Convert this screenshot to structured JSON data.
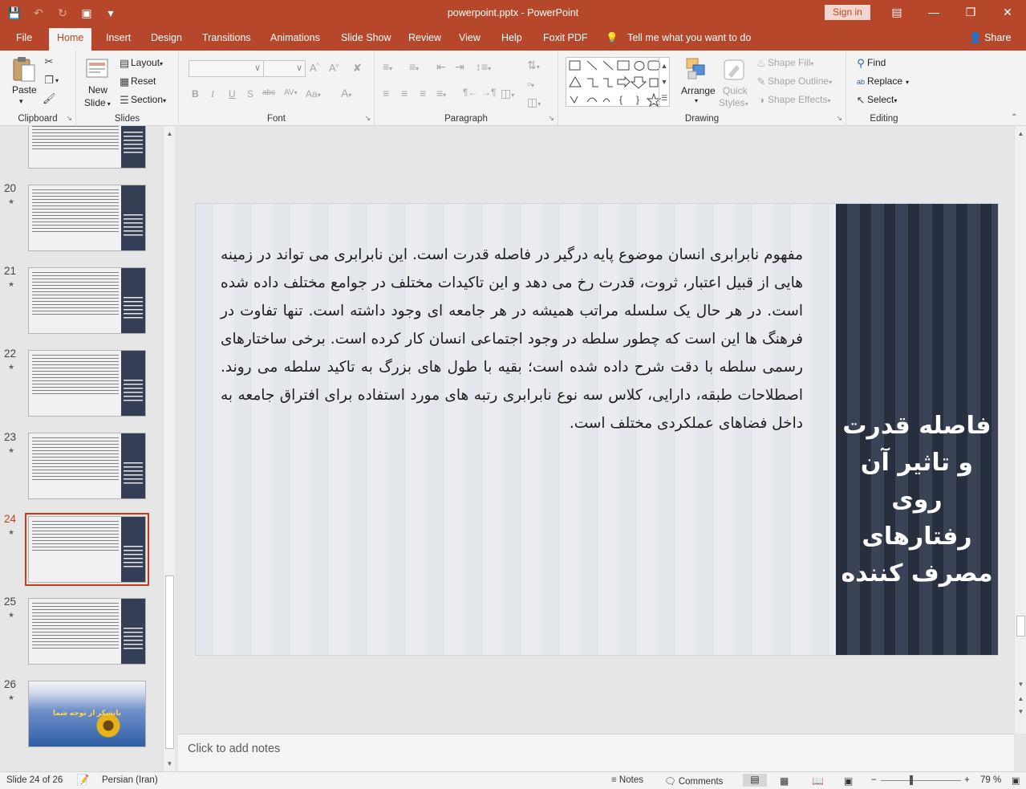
{
  "window": {
    "title": "powerpoint.pptx  -  PowerPoint",
    "sign_in": "Sign in"
  },
  "tabs": [
    "File",
    "Home",
    "Insert",
    "Design",
    "Transitions",
    "Animations",
    "Slide Show",
    "Review",
    "View",
    "Help",
    "Foxit PDF"
  ],
  "active_tab": "Home",
  "tell_me": "Tell me what you want to do",
  "share": "Share",
  "ribbon": {
    "clipboard": {
      "label": "Clipboard",
      "paste": "Paste"
    },
    "slides": {
      "label": "Slides",
      "new_slide_1": "New",
      "new_slide_2": "Slide",
      "layout": "Layout",
      "reset": "Reset",
      "section": "Section"
    },
    "font": {
      "label": "Font",
      "font_name": "",
      "font_size": "",
      "bold": "B",
      "italic": "I",
      "underline": "U",
      "shadow": "S",
      "strike": "abc",
      "spacing": "AV",
      "case": "Aa",
      "color": "A"
    },
    "paragraph": {
      "label": "Paragraph"
    },
    "drawing": {
      "label": "Drawing",
      "arrange": "Arrange",
      "quick_styles_1": "Quick",
      "quick_styles_2": "Styles",
      "shape_fill": "Shape Fill",
      "shape_outline": "Shape Outline",
      "shape_effects": "Shape Effects"
    },
    "editing": {
      "label": "Editing",
      "find": "Find",
      "replace": "Replace",
      "select": "Select"
    }
  },
  "thumbnails": [
    {
      "num": "20",
      "active": false
    },
    {
      "num": "21",
      "active": false
    },
    {
      "num": "22",
      "active": false
    },
    {
      "num": "23",
      "active": false
    },
    {
      "num": "24",
      "active": true
    },
    {
      "num": "25",
      "active": false
    },
    {
      "num": "26",
      "active": false
    }
  ],
  "last_thumb_label": "باتشکر از توجه شما",
  "slide": {
    "body": "مفهوم نابرابری انسان موضوع پایه درگیر در فاصله قدرت است. این نابرابری می تواند در زمینه هایی از قبیل اعتبار، ثروت، قدرت رخ می دهد و این تاکیدات مختلف در جوامع مختلف داده شده است. در هر حال یک سلسله مراتب همیشه در هر جامعه ای وجود داشته است. تنها تفاوت در فرهنگ ها این است که چطور سلطه در وجود اجتماعی انسان کار کرده است. برخی ساختارهای رسمی سلطه با دقت شرح داده شده است؛ بقیه با طول های بزرگ به تاکید سلطه می روند. اصطلاحات طبقه، دارایی، کلاس سه نوع نابرابری رتبه های مورد استفاده برای افتراق جامعه به داخل فضاهای عملکردی مختلف است.",
    "title": "فاصله قدرت و تاثیر آن روی رفتارهای مصرف کننده"
  },
  "notes_placeholder": "Click to add notes",
  "status": {
    "slide_info": "Slide 24 of 26",
    "language": "Persian (Iran)",
    "notes": "Notes",
    "comments": "Comments",
    "zoom": "79 %"
  },
  "colors": {
    "accent": "#b7472a",
    "active_thumb": "#c43e1c",
    "title_panel": "#2f384c"
  }
}
